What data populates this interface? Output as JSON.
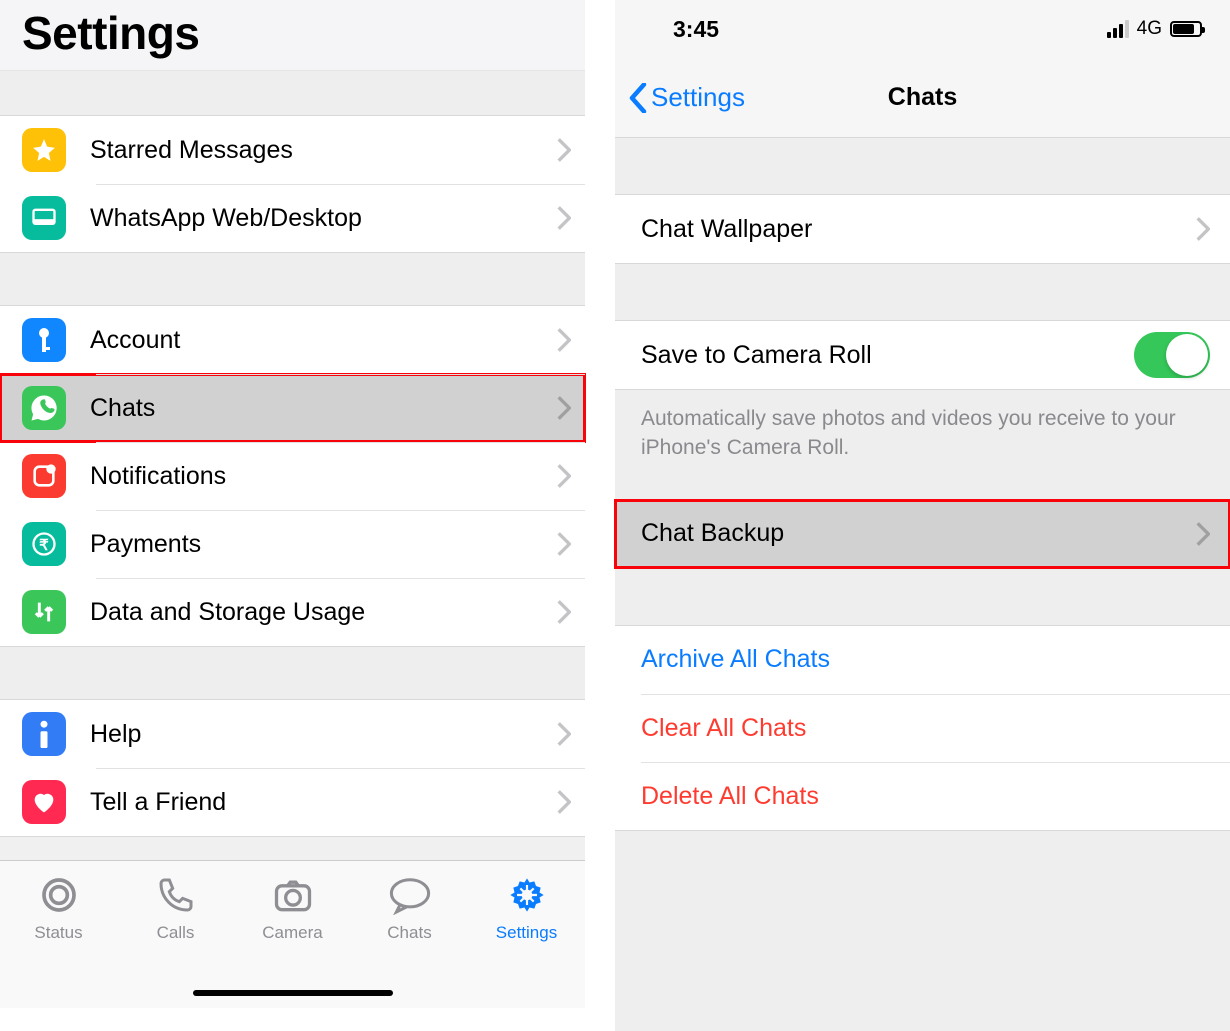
{
  "left": {
    "title": "Settings",
    "group1": [
      {
        "label": "Starred Messages"
      },
      {
        "label": "WhatsApp Web/Desktop"
      }
    ],
    "group2": [
      {
        "label": "Account"
      },
      {
        "label": "Chats"
      },
      {
        "label": "Notifications"
      },
      {
        "label": "Payments"
      },
      {
        "label": "Data and Storage Usage"
      }
    ],
    "group3": [
      {
        "label": "Help"
      },
      {
        "label": "Tell a Friend"
      }
    ],
    "tabs": {
      "status": "Status",
      "calls": "Calls",
      "camera": "Camera",
      "chats": "Chats",
      "settings": "Settings"
    }
  },
  "right": {
    "time": "3:45",
    "network": "4G",
    "back": "Settings",
    "title": "Chats",
    "items": {
      "wallpaper": "Chat Wallpaper",
      "save_roll": "Save to Camera Roll",
      "save_roll_desc": "Automatically save photos and videos you receive to your iPhone's Camera Roll.",
      "backup": "Chat Backup",
      "archive": "Archive All Chats",
      "clear": "Clear All Chats",
      "delete": "Delete All Chats"
    }
  }
}
